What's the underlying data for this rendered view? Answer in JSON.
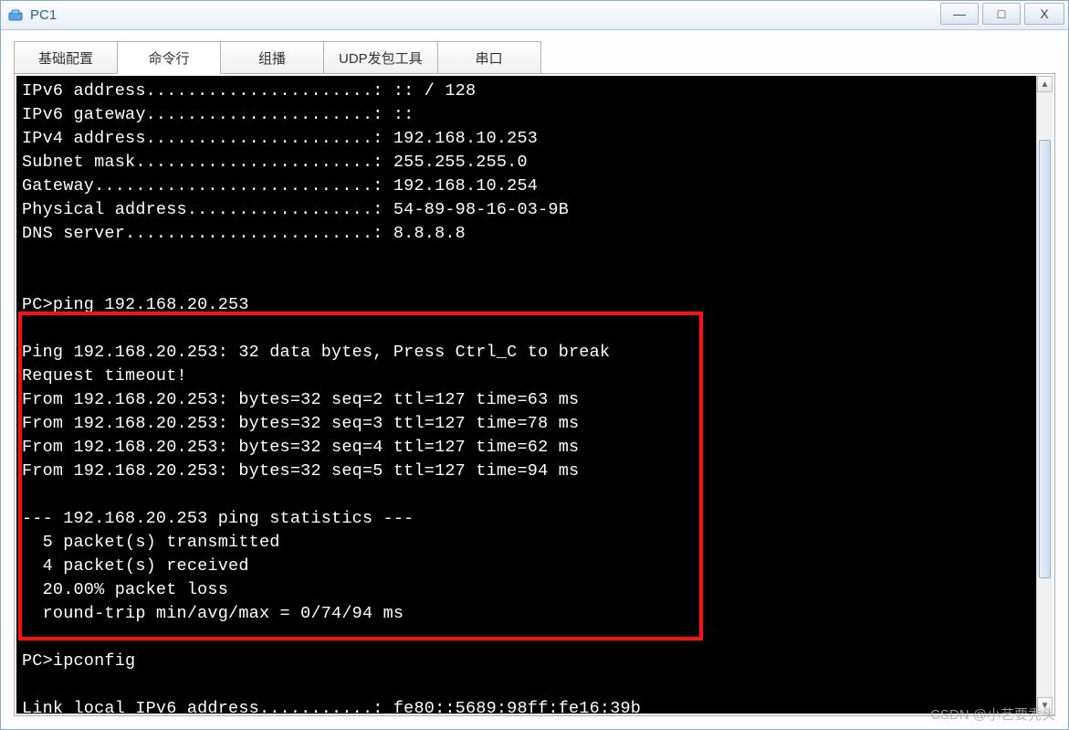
{
  "window": {
    "title": "PC1",
    "controls": {
      "min": "—",
      "max": "□",
      "close": "X"
    }
  },
  "tabs": {
    "items": [
      {
        "label": "基础配置"
      },
      {
        "label": "命令行"
      },
      {
        "label": "组播"
      },
      {
        "label": "UDP发包工具"
      },
      {
        "label": "串口"
      }
    ],
    "active_index": 1
  },
  "terminal": {
    "lines": [
      "IPv6 address......................: :: / 128",
      "IPv6 gateway......................: ::",
      "IPv4 address......................: 192.168.10.253",
      "Subnet mask.......................: 255.255.255.0",
      "Gateway...........................: 192.168.10.254",
      "Physical address..................: 54-89-98-16-03-9B",
      "DNS server........................: 8.8.8.8",
      "",
      "",
      "PC>ping 192.168.20.253",
      "",
      "Ping 192.168.20.253: 32 data bytes, Press Ctrl_C to break",
      "Request timeout!",
      "From 192.168.20.253: bytes=32 seq=2 ttl=127 time=63 ms",
      "From 192.168.20.253: bytes=32 seq=3 ttl=127 time=78 ms",
      "From 192.168.20.253: bytes=32 seq=4 ttl=127 time=62 ms",
      "From 192.168.20.253: bytes=32 seq=5 ttl=127 time=94 ms",
      "",
      "--- 192.168.20.253 ping statistics ---",
      "  5 packet(s) transmitted",
      "  4 packet(s) received",
      "  20.00% packet loss",
      "  round-trip min/avg/max = 0/74/94 ms",
      "",
      "PC>ipconfig",
      "",
      "Link local IPv6 address...........: fe80::5689:98ff:fe16:39b"
    ]
  },
  "scrollbar": {
    "up": "▲",
    "down": "▼"
  },
  "watermark": "CSDN @小艺要秃头"
}
